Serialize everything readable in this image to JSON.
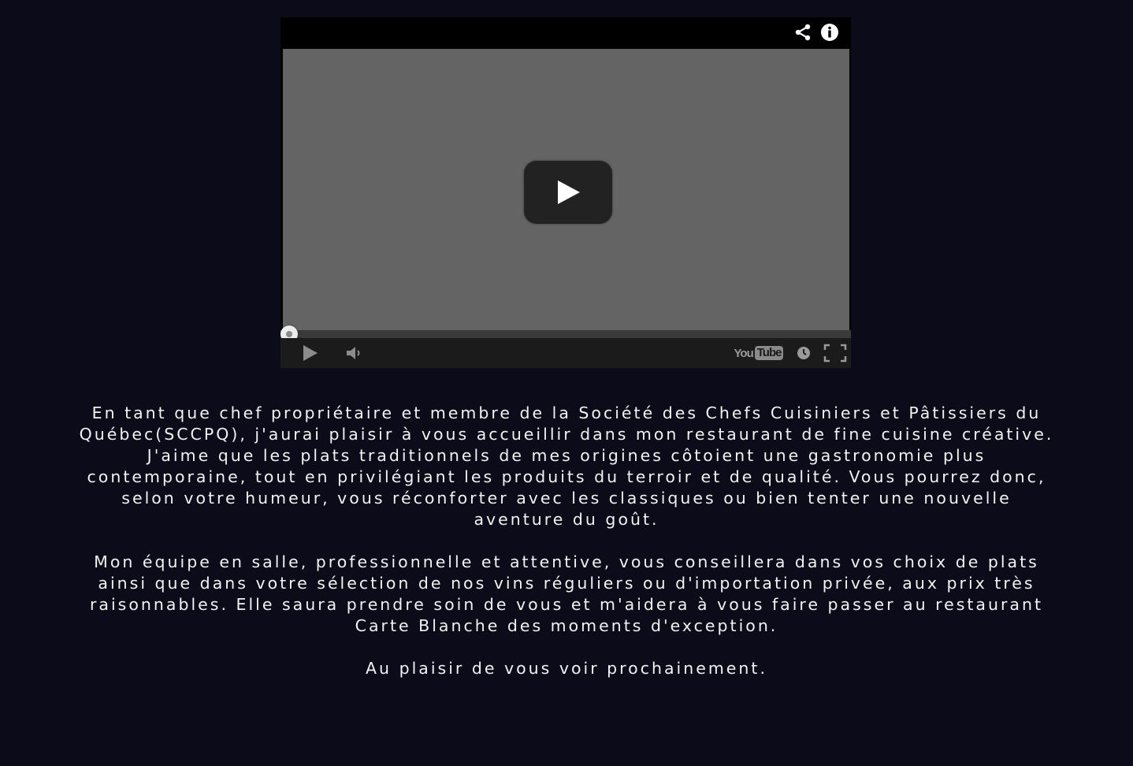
{
  "player": {
    "icons": {
      "share": "share-icon",
      "info": "info-icon",
      "play": "play-icon",
      "volume": "volume-icon",
      "watch_later": "clock-icon",
      "fullscreen": "fullscreen-icon"
    },
    "youtube_logo": {
      "you": "You",
      "tube": "Tube"
    },
    "progress": 0,
    "colors": {
      "video_bg": "#646464",
      "bar_bg": "#000000",
      "controls_bg": "#1b1b1b"
    }
  },
  "content": {
    "paragraph1": "En tant que chef propriétaire et membre de la Société des Chefs Cuisiniers et Pâtissiers du Québec(SCCPQ), j'aurai plaisir à vous accueillir dans mon restaurant de fine cuisine créative.",
    "paragraph2": "J'aime que les plats traditionnels de mes origines côtoient une gastronomie plus contemporaine, tout en privilégiant les produits du terroir et de qualité. Vous pourrez donc, selon votre humeur, vous réconforter avec les classiques ou bien tenter une nouvelle aventure du goût.",
    "paragraph3": "Mon équipe en salle, professionnelle et attentive, vous conseillera dans vos choix de plats ainsi que dans votre sélection de nos vins réguliers ou d'importation privée, aux prix très raisonnables. Elle saura prendre soin de vous et m'aidera à vous faire passer au restaurant Carte Blanche des moments d'exception.",
    "closing": "Au plaisir de vous voir prochainement."
  },
  "colors": {
    "page_bg": "#0b0b1a",
    "text": "#f2f2f2"
  }
}
